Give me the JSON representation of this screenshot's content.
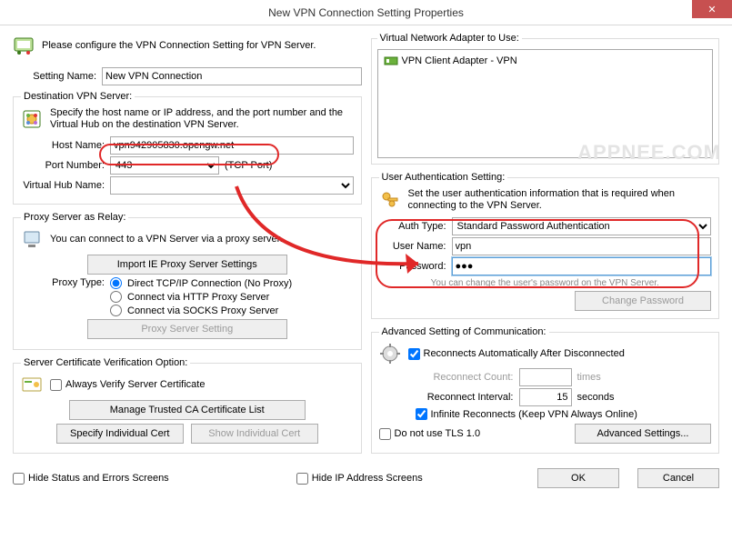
{
  "window": {
    "title": "New VPN Connection Setting Properties",
    "close_glyph": "✕"
  },
  "intro": {
    "text": "Please configure the VPN Connection Setting for VPN Server."
  },
  "setting_name": {
    "label": "Setting Name:",
    "value": "New VPN Connection"
  },
  "dest": {
    "legend": "Destination VPN Server:",
    "hint": "Specify the host name or IP address, and the port number and the Virtual Hub on the destination VPN Server.",
    "host_label": "Host Name:",
    "host_value": "vpn942905830.opengw.net",
    "port_label": "Port Number:",
    "port_value": "443",
    "port_note": "(TCP Port)",
    "vhub_label": "Virtual Hub Name:",
    "vhub_value": ""
  },
  "proxy": {
    "legend": "Proxy Server as Relay:",
    "hint": "You can connect to a VPN Server via a proxy server.",
    "import_btn": "Import IE Proxy Server Settings",
    "type_label": "Proxy Type:",
    "opt_direct": "Direct TCP/IP Connection (No Proxy)",
    "opt_http": "Connect via HTTP Proxy Server",
    "opt_socks": "Connect via SOCKS Proxy Server",
    "setting_btn": "Proxy Server Setting"
  },
  "cert": {
    "legend": "Server Certificate Verification Option:",
    "always": "Always Verify Server Certificate",
    "manage_btn": "Manage Trusted CA Certificate List",
    "specify_btn": "Specify Individual Cert",
    "show_btn": "Show Individual Cert"
  },
  "adapter": {
    "legend": "Virtual Network Adapter to Use:",
    "item": "VPN Client Adapter - VPN"
  },
  "auth": {
    "legend": "User Authentication Setting:",
    "hint": "Set the user authentication information that is required when connecting to the VPN Server.",
    "type_label": "Auth Type:",
    "type_value": "Standard Password Authentication",
    "user_label": "User Name:",
    "user_value": "vpn",
    "pass_label": "Password:",
    "pass_value": "●●●",
    "note": "You can change the user's password on the VPN Server.",
    "change_btn": "Change Password"
  },
  "adv": {
    "legend": "Advanced Setting of Communication:",
    "reconnect_auto": "Reconnects Automatically After Disconnected",
    "reconnect_count_label": "Reconnect Count:",
    "reconnect_count_unit": "times",
    "reconnect_interval_label": "Reconnect Interval:",
    "reconnect_interval_value": "15",
    "reconnect_interval_unit": "seconds",
    "infinite": "Infinite Reconnects (Keep VPN Always Online)",
    "no_tls": "Do not use TLS 1.0",
    "adv_btn": "Advanced Settings..."
  },
  "bottom": {
    "hide_status": "Hide Status and Errors Screens",
    "hide_ip": "Hide IP Address Screens",
    "ok": "OK",
    "cancel": "Cancel"
  },
  "watermark": "APPNEE.COM"
}
